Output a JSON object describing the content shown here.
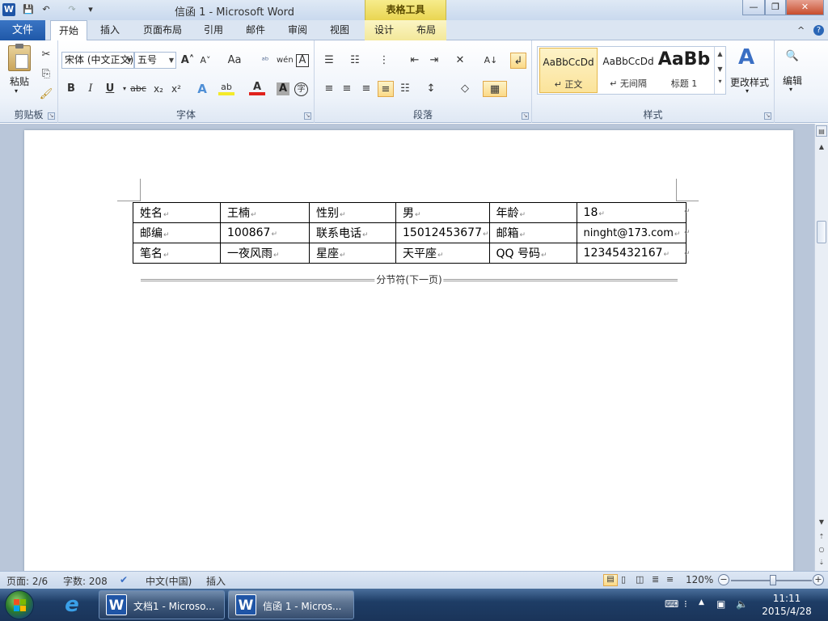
{
  "window": {
    "title": "信函 1  -  Microsoft Word",
    "context_tools": "表格工具",
    "controls": {
      "minimize": "—",
      "restore": "❐",
      "close": "✕"
    }
  },
  "qat": {
    "app_icon": "W",
    "save": "💾",
    "undo": "↶",
    "redo": "↷",
    "customize": "▾"
  },
  "tabs": {
    "file": "文件",
    "items": [
      "开始",
      "插入",
      "页面布局",
      "引用",
      "邮件",
      "审阅",
      "视图"
    ],
    "context": [
      "设计",
      "布局"
    ],
    "active": "开始",
    "right_icons": {
      "collapse": "^",
      "help": "?"
    }
  },
  "ribbon": {
    "clipboard": {
      "label": "剪贴板",
      "paste": "粘贴"
    },
    "font": {
      "label": "字体",
      "font_name": "宋体 (中文正文)",
      "font_size": "五号",
      "buttons": {
        "bold": "B",
        "italic": "I",
        "underline": "U",
        "strike": "abc",
        "subscript": "x₂",
        "superscript": "x²",
        "grow": "A˄",
        "shrink": "A˅",
        "change_case": "Aa",
        "clear": "A",
        "text_effect": "A",
        "highlight": "ab",
        "font_color": "A",
        "char_shade": "A",
        "enclose": "字"
      }
    },
    "paragraph": {
      "label": "段落"
    },
    "styles": {
      "label": "样式",
      "items": [
        {
          "sample": "AaBbCcDd",
          "name": "正文"
        },
        {
          "sample": "AaBbCcDd",
          "name": "无间隔"
        },
        {
          "sample": "AaBb",
          "name": "标题 1"
        }
      ],
      "change_styles": "更改样式"
    },
    "editing": {
      "label": "编辑"
    }
  },
  "document": {
    "table": [
      [
        "姓名",
        "王楠",
        "性别",
        "男",
        "年龄",
        "18"
      ],
      [
        "邮编",
        "100867",
        "联系电话",
        "15012453677",
        "邮箱",
        "ninght@173.com"
      ],
      [
        "笔名",
        "一夜风雨",
        "星座",
        "天平座",
        "QQ 号码",
        "12345432167"
      ]
    ],
    "paragraph_mark": "↵",
    "section_break": "分节符(下一页)"
  },
  "statusbar": {
    "page": "页面: 2/6",
    "words": "字数: 208",
    "language": "中文(中国)",
    "mode": "插入",
    "zoom": "120%",
    "zoom_minus": "−",
    "zoom_plus": "+"
  },
  "taskbar": {
    "ie": "e",
    "apps": [
      {
        "icon": "W",
        "label": "文档1 - Microso..."
      },
      {
        "icon": "W",
        "label": "信函 1 - Micros..."
      }
    ],
    "clock_time": "11:11",
    "clock_date": "2015/4/28"
  },
  "colors": {
    "file_tab": "#2a66b6",
    "ctx_tools": "#e9d551",
    "page_bg": "#b9c6d9"
  }
}
